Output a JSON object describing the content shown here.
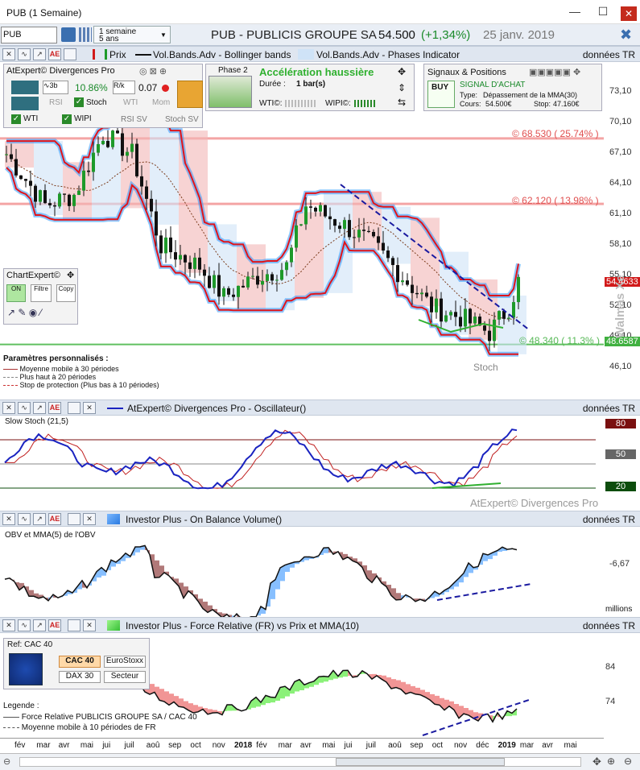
{
  "window": {
    "title": "PUB (1 Semaine)",
    "minimize": "—",
    "maximize": "☐",
    "close": "✕"
  },
  "header": {
    "symbol": "PUB",
    "period_main": "1 semaine",
    "period_sub": "5 ans",
    "title": "PUB - PUBLICIS GROUPE SA",
    "price": "54.500",
    "change": "(+1,34%)",
    "date": "25 janv. 2019"
  },
  "price_toolbar": {
    "prix": "Prix",
    "boll": "Vol.Bands.Adv - Bollinger bands",
    "phases": "Vol.Bands.Adv - Phases Indicator",
    "donnees": "données TR"
  },
  "atexpert_panel": {
    "title": "AtExpert© Divergences Pro",
    "pct": "10.86%",
    "ratio": "0.07",
    "rsi": "RSI",
    "stoch": "Stoch",
    "wti": "WTI",
    "mom": "Mom",
    "wti2": "WTI",
    "wipi": "WIPI",
    "rsi_sv": "RSI SV",
    "stoch_sv": "Stoch SV"
  },
  "phase_panel": {
    "phase": "Phase 2",
    "title": "Accélération haussière",
    "duree_label": "Durée :",
    "duree": "1 bar(s)",
    "wti": "WTI©:",
    "wipi": "WIPI©:"
  },
  "signals_panel": {
    "title": "Signaux & Positions",
    "buy": "BUY",
    "signal": "SIGNAL D'ACHAT",
    "type_label": "Type:",
    "type": "Dépassement de la MMA(30)",
    "cours_label": "Cours:",
    "cours": "54.500€",
    "stop_label": "Stop:",
    "stop": "47.160€"
  },
  "chartexpert": {
    "title": "ChartExpert©",
    "on": "ON",
    "filtre": "Filtre",
    "copy": "Copy"
  },
  "price_chart": {
    "y_ticks": [
      "73,10",
      "70,10",
      "67,10",
      "64,10",
      "61,10",
      "58,10",
      "55,10",
      "52,10",
      "49,10",
      "46,10"
    ],
    "y_values": [
      73.1,
      70.1,
      67.1,
      64.1,
      61.1,
      58.1,
      55.1,
      52.1,
      49.1,
      46.1
    ],
    "level_high": "© 68.530 ( 25.74% )",
    "level_mid": "© 62.120 ( 13.98% )",
    "level_low": "© 48.340 ( 11.3% )",
    "last_price_tag": "54.4633",
    "low_tag": "48.6587",
    "stoch_label": "Stoch",
    "watermark": "Walmas Xe",
    "params_title": "Paramètres personnalisés :",
    "params": [
      "Moyenne mobile à 30 périodes",
      "Plus haut à 20 périodes",
      "Stop de protection (Plus bas à 10 périodes)"
    ]
  },
  "stoch_panel": {
    "toolbar": "AtExpert© Divergences Pro - Oscillateur()",
    "donnees": "données TR",
    "label": "Slow Stoch  (21,5)",
    "levels": [
      "80",
      "50",
      "20"
    ],
    "watermark": "AtExpert© Divergences Pro"
  },
  "obv_panel": {
    "toolbar": "Investor Plus - On Balance Volume()",
    "donnees": "données TR",
    "label": "OBV et MMA(5) de l'OBV",
    "tick": "-6,67",
    "unit": "millions"
  },
  "fr_panel": {
    "toolbar": "Investor Plus - Force Relative (FR) vs Prix et MMA(10)",
    "donnees": "données TR",
    "ref_title": "Ref: CAC 40",
    "btn_cac": "CAC 40",
    "btn_euro": "EuroStoxx",
    "btn_dax": "DAX 30",
    "btn_sect": "Secteur",
    "ticks": [
      "84",
      "74"
    ],
    "legend_title": "Legende :",
    "legend": [
      "Force Relative PUBLICIS GROUPE SA / CAC 40",
      "Moyenne mobile à 10 périodes de FR"
    ]
  },
  "x_axis": {
    "labels": [
      "fév",
      "mar",
      "avr",
      "mai",
      "jui",
      "juil",
      "aoû",
      "sep",
      "oct",
      "nov",
      "2018",
      "fév",
      "mar",
      "avr",
      "mai",
      "jui",
      "juil",
      "aoû",
      "sep",
      "oct",
      "nov",
      "déc",
      "2019",
      "mar",
      "avr",
      "mai"
    ]
  },
  "colors": {
    "up": "#1e9a2a",
    "down": "#d11a1a",
    "band_red": "#e0141a",
    "band_blue": "#1e90ff",
    "accent": "#1a8a2a"
  }
}
